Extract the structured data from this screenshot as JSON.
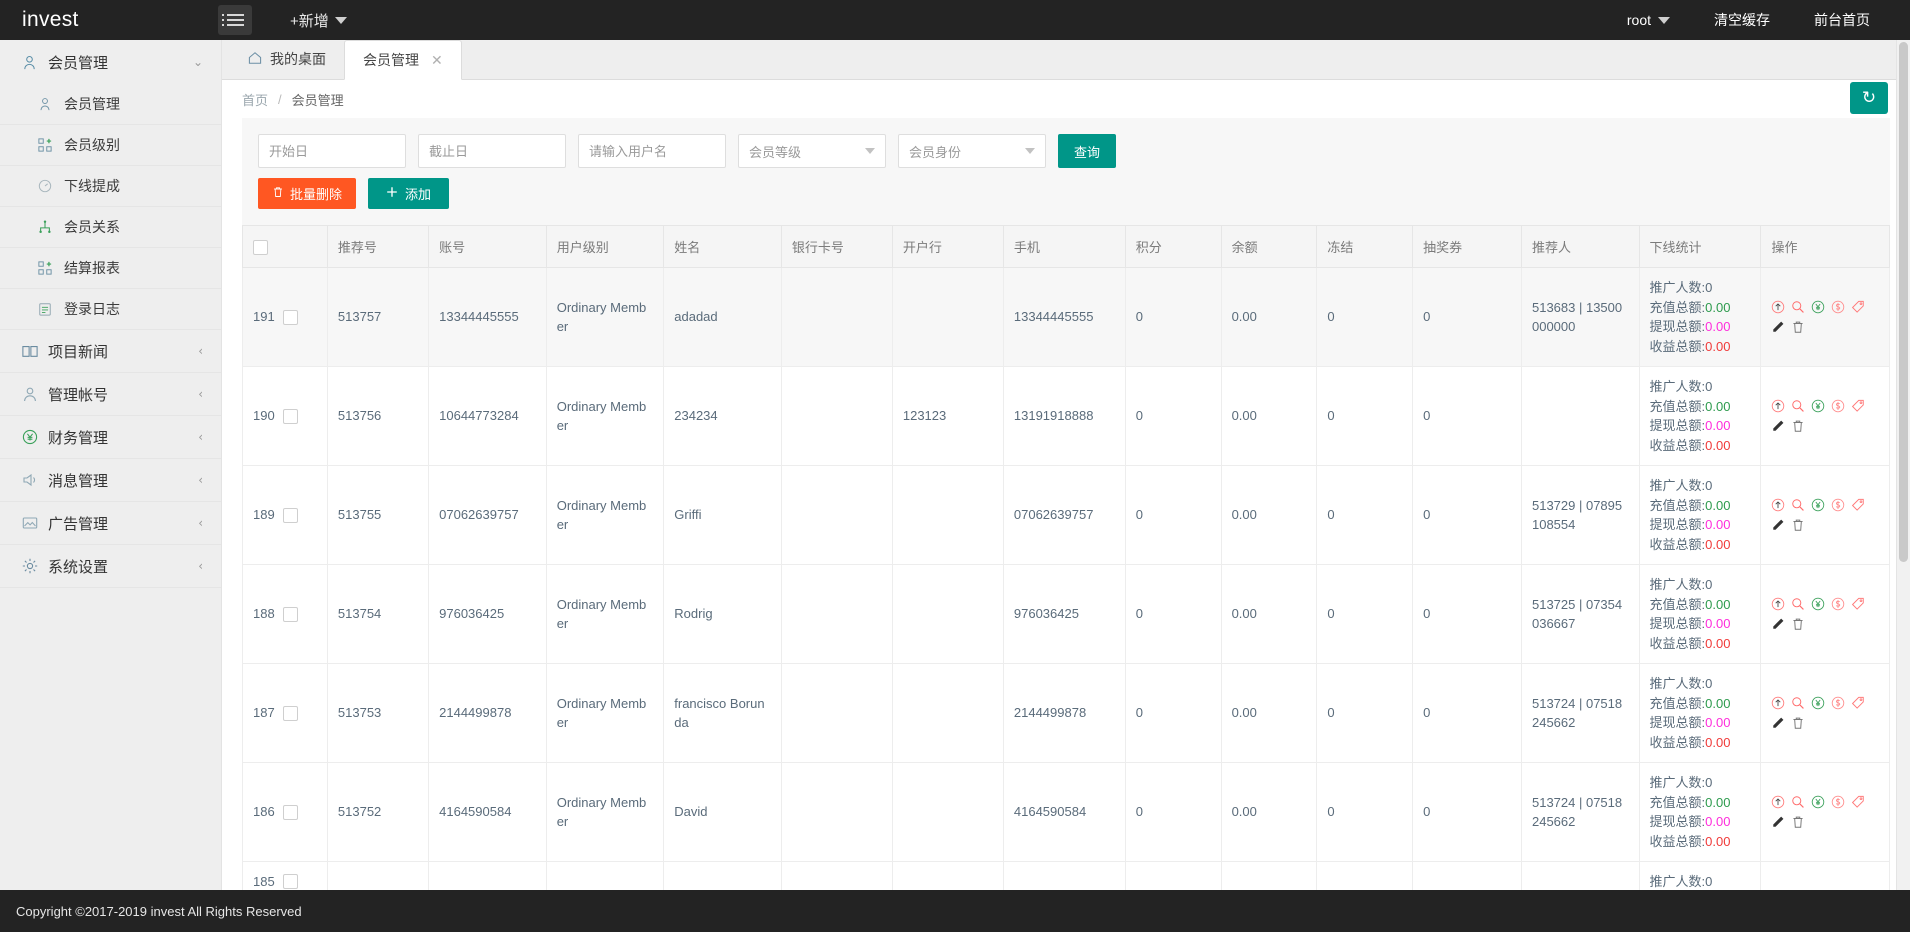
{
  "topbar": {
    "brand": "invest",
    "menu_toggle_icon": "hamburger-icon",
    "add_new_label": "+新增",
    "user_label": "root",
    "clear_cache_label": "清空缓存",
    "frontend_home_label": "前台首页"
  },
  "sidebar": {
    "group": {
      "label": "会员管理",
      "icon": "user-icon",
      "expanded": true,
      "sub_items": [
        {
          "label": "会员管理",
          "icon": "user-icon"
        },
        {
          "label": "会员级别",
          "icon": "grid-plus-icon"
        },
        {
          "label": "下线提成",
          "icon": "gauge-icon"
        },
        {
          "label": "会员关系",
          "icon": "sitemap-icon"
        },
        {
          "label": "结算报表",
          "icon": "grid-plus-icon"
        },
        {
          "label": "登录日志",
          "icon": "clipboard-icon"
        }
      ]
    },
    "items": [
      {
        "label": "项目新闻",
        "icon": "book-icon",
        "arrow": "chevron-left-icon"
      },
      {
        "label": "管理帐号",
        "icon": "user-circle-icon",
        "arrow": "chevron-left-icon"
      },
      {
        "label": "财务管理",
        "icon": "yen-circle-icon",
        "arrow": "chevron-left-icon"
      },
      {
        "label": "消息管理",
        "icon": "speaker-icon",
        "arrow": "chevron-left-icon"
      },
      {
        "label": "广告管理",
        "icon": "image-icon",
        "arrow": "chevron-left-icon"
      },
      {
        "label": "系统设置",
        "icon": "gear-icon",
        "arrow": "chevron-left-icon"
      }
    ]
  },
  "tabs": [
    {
      "label": "我的桌面",
      "icon": "home-icon",
      "active": false,
      "closable": false
    },
    {
      "label": "会员管理",
      "icon": "",
      "active": true,
      "closable": true
    }
  ],
  "breadcrumb": {
    "home": "首页",
    "separator": "/",
    "current": "会员管理"
  },
  "refresh": {
    "icon": "refresh-icon",
    "label": ""
  },
  "filters": {
    "start_date": {
      "value": "",
      "placeholder": "开始日"
    },
    "end_date": {
      "value": "",
      "placeholder": "截止日"
    },
    "username": {
      "value": "",
      "placeholder": "请输入用户名"
    },
    "member_level": {
      "selected": "会员等级",
      "caret": "caret-down-icon"
    },
    "member_identity": {
      "selected": "会员身份",
      "caret": "caret-down-icon"
    },
    "search_button": "查询"
  },
  "actions": {
    "batch_delete": {
      "label": "批量删除",
      "icon": "trash-icon",
      "color": "#ff5722"
    },
    "add": {
      "label": "添加",
      "icon": "plus-icon",
      "color": "#009688"
    }
  },
  "table": {
    "select_all_checkbox": "",
    "columns": [
      "",
      "推荐号",
      "账号",
      "用户级别",
      "姓名",
      "银行卡号",
      "开户行",
      "手机",
      "积分",
      "余额",
      "冻结",
      "抽奖券",
      "推荐人",
      "下线统计",
      "操作"
    ],
    "stat_labels": {
      "promoters": "推广人数:",
      "recharge": "充值总额:",
      "withdraw": "提现总额:",
      "income": "收益总额:"
    },
    "op_icons": [
      "arrow-up-circle-icon",
      "search-icon",
      "yen-circle-icon",
      "dollar-circle-icon",
      "tag-icon",
      "edit-pencil-icon",
      "trash-icon"
    ],
    "rows": [
      {
        "id": "191",
        "ref_no": "513757",
        "account": "13344445555",
        "level": "Ordinary Member",
        "name": "adadad",
        "bank_card": "",
        "bank_branch": "",
        "phone": "13344445555",
        "points": "0",
        "balance": "0.00",
        "frozen": "0",
        "lottery": "0",
        "referrer": "513683 | 13500000000",
        "stats": {
          "promoters": "0",
          "recharge": "0.00",
          "withdraw": "0.00",
          "income": "0.00"
        }
      },
      {
        "id": "190",
        "ref_no": "513756",
        "account": "10644773284",
        "level": "Ordinary Member",
        "name": "234234",
        "bank_card": "",
        "bank_branch": "123123",
        "phone": "13191918888",
        "points": "0",
        "balance": "0.00",
        "frozen": "0",
        "lottery": "0",
        "referrer": "",
        "stats": {
          "promoters": "0",
          "recharge": "0.00",
          "withdraw": "0.00",
          "income": "0.00"
        }
      },
      {
        "id": "189",
        "ref_no": "513755",
        "account": "07062639757",
        "level": "Ordinary Member",
        "name": "Griffi",
        "bank_card": "",
        "bank_branch": "",
        "phone": "07062639757",
        "points": "0",
        "balance": "0.00",
        "frozen": "0",
        "lottery": "0",
        "referrer": "513729 | 07895108554",
        "stats": {
          "promoters": "0",
          "recharge": "0.00",
          "withdraw": "0.00",
          "income": "0.00"
        }
      },
      {
        "id": "188",
        "ref_no": "513754",
        "account": "976036425",
        "level": "Ordinary Member",
        "name": "Rodrig",
        "bank_card": "",
        "bank_branch": "",
        "phone": "976036425",
        "points": "0",
        "balance": "0.00",
        "frozen": "0",
        "lottery": "0",
        "referrer": "513725 | 07354036667",
        "stats": {
          "promoters": "0",
          "recharge": "0.00",
          "withdraw": "0.00",
          "income": "0.00"
        }
      },
      {
        "id": "187",
        "ref_no": "513753",
        "account": "2144499878",
        "level": "Ordinary Member",
        "name": "francisco Borunda",
        "bank_card": "",
        "bank_branch": "",
        "phone": "2144499878",
        "points": "0",
        "balance": "0.00",
        "frozen": "0",
        "lottery": "0",
        "referrer": "513724 | 07518245662",
        "stats": {
          "promoters": "0",
          "recharge": "0.00",
          "withdraw": "0.00",
          "income": "0.00"
        }
      },
      {
        "id": "186",
        "ref_no": "513752",
        "account": "4164590584",
        "level": "Ordinary Member",
        "name": "David",
        "bank_card": "",
        "bank_branch": "",
        "phone": "4164590584",
        "points": "0",
        "balance": "0.00",
        "frozen": "0",
        "lottery": "0",
        "referrer": "513724 | 07518245662",
        "stats": {
          "promoters": "0",
          "recharge": "0.00",
          "withdraw": "0.00",
          "income": "0.00"
        }
      },
      {
        "id": "185",
        "ref_no": "",
        "account": "",
        "level": "",
        "name": "",
        "bank_card": "",
        "bank_branch": "",
        "phone": "",
        "points": "",
        "balance": "",
        "frozen": "",
        "lottery": "",
        "referrer": "",
        "stats": {
          "promoters": "0",
          "recharge": "",
          "withdraw": "",
          "income": ""
        }
      }
    ]
  },
  "footer": {
    "copyright": "Copyright ©2017-2019 invest All Rights Reserved"
  },
  "colors": {
    "topbar": "#232323",
    "sidebar": "#eeeeee",
    "primary": "#009688",
    "danger": "#ff5722",
    "green_value": "#2e9b4e",
    "pink_value": "#ff2ddb",
    "red_value": "#f03a3a"
  }
}
